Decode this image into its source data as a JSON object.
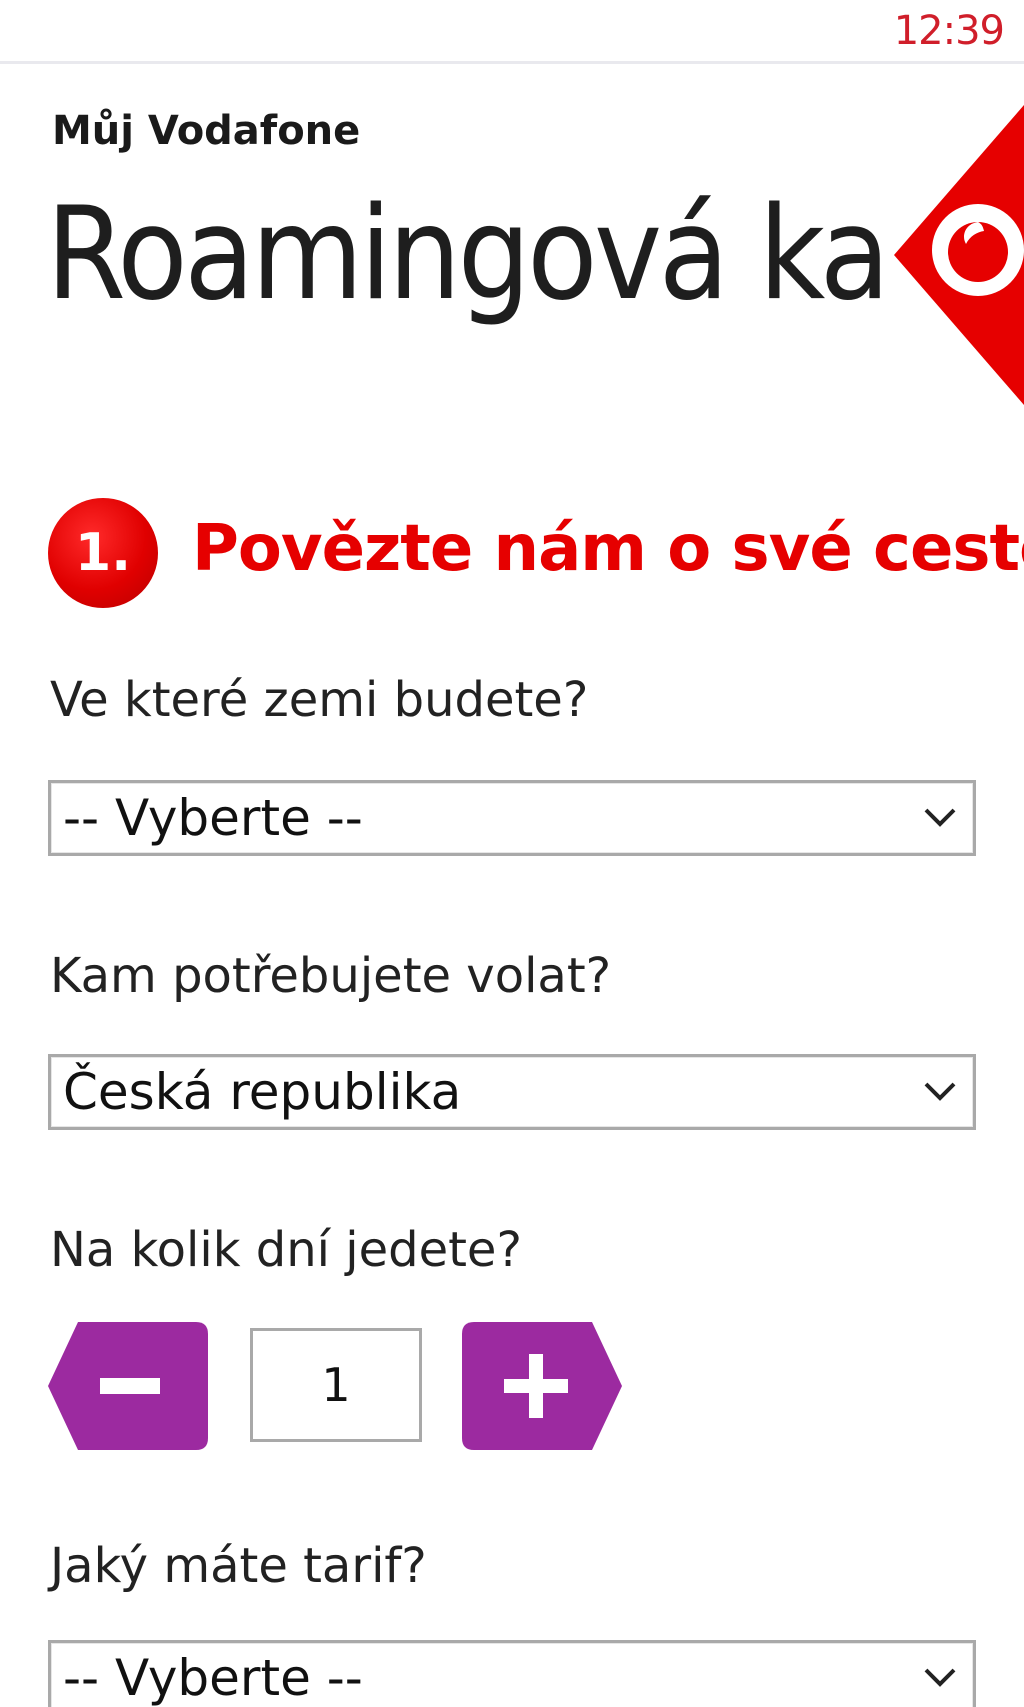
{
  "status_bar": {
    "time": "12:39"
  },
  "header": {
    "app_name": "Můj Vodafone",
    "page_title": "Roamingová kalkulačka",
    "brand_icon": "vodafone-logo-icon"
  },
  "step": {
    "number": "1.",
    "title": "Povězte nám o své cestě"
  },
  "form": {
    "country": {
      "label": "Ve které zemi budete?",
      "value": "-- Vyberte --"
    },
    "call_destination": {
      "label": "Kam potřebujete volat?",
      "value": "Česká republika"
    },
    "days": {
      "label": "Na kolik dní jedete?",
      "value": "1",
      "decrement_icon": "minus-icon",
      "increment_icon": "plus-icon"
    },
    "tariff": {
      "label": "Jaký máte tarif?",
      "value": "-- Vyberte --"
    }
  },
  "colors": {
    "brand_red": "#e60000",
    "stepper_purple": "#9c2aa0",
    "time_red": "#d01e2a"
  }
}
